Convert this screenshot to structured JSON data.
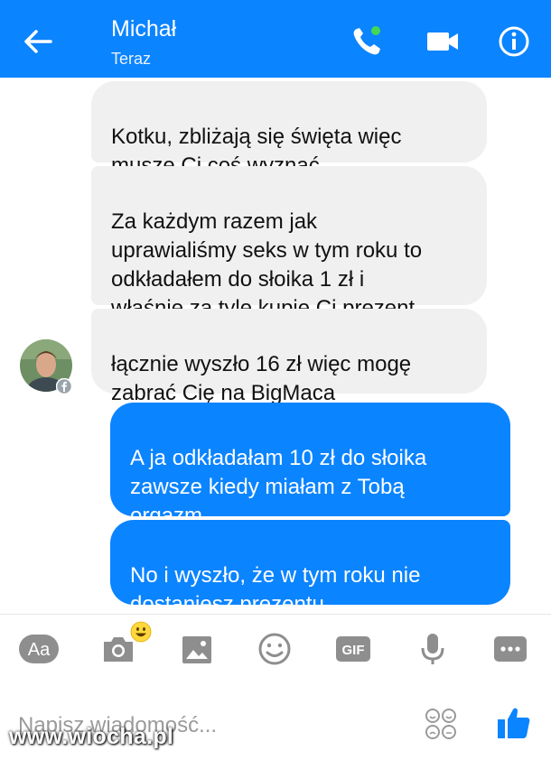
{
  "header": {
    "contact_name": "Michał",
    "status": "Teraz",
    "icons": [
      "back-arrow-icon",
      "phone-icon",
      "video-camera-icon",
      "info-icon"
    ],
    "bg_color": "#0b84ff"
  },
  "messages": [
    {
      "side": "incoming",
      "text": "Kotku, zbliżają się święta więc\nmuszę Ci coś wyznać"
    },
    {
      "side": "incoming",
      "text": "Za każdym razem jak\nuprawialiśmy seks w tym roku to\nodkładałem do słoika 1 zł i\nwłaśnie za tyle kupię Ci prezent"
    },
    {
      "side": "incoming",
      "text": "łącznie wyszło 16 zł więc mogę\nzabrać Cię na BigMaca"
    },
    {
      "side": "outgoing",
      "text": "A ja odkładałam 10 zł do słoika\nzawsze kiedy miałam z Tobą\norgazm"
    },
    {
      "side": "outgoing",
      "text": "No i wyszło, że w tym roku nie\ndostaniesz prezentu"
    }
  ],
  "toolbar": {
    "aa_label": "Aa",
    "gif_label": "GIF",
    "icons": [
      "text-format-icon",
      "camera-icon",
      "image-icon",
      "emoji-icon",
      "gif-icon",
      "microphone-icon",
      "more-icon"
    ]
  },
  "composer": {
    "placeholder": "Napisz wiadomość..."
  },
  "watermark": "www.wiocha.pl"
}
